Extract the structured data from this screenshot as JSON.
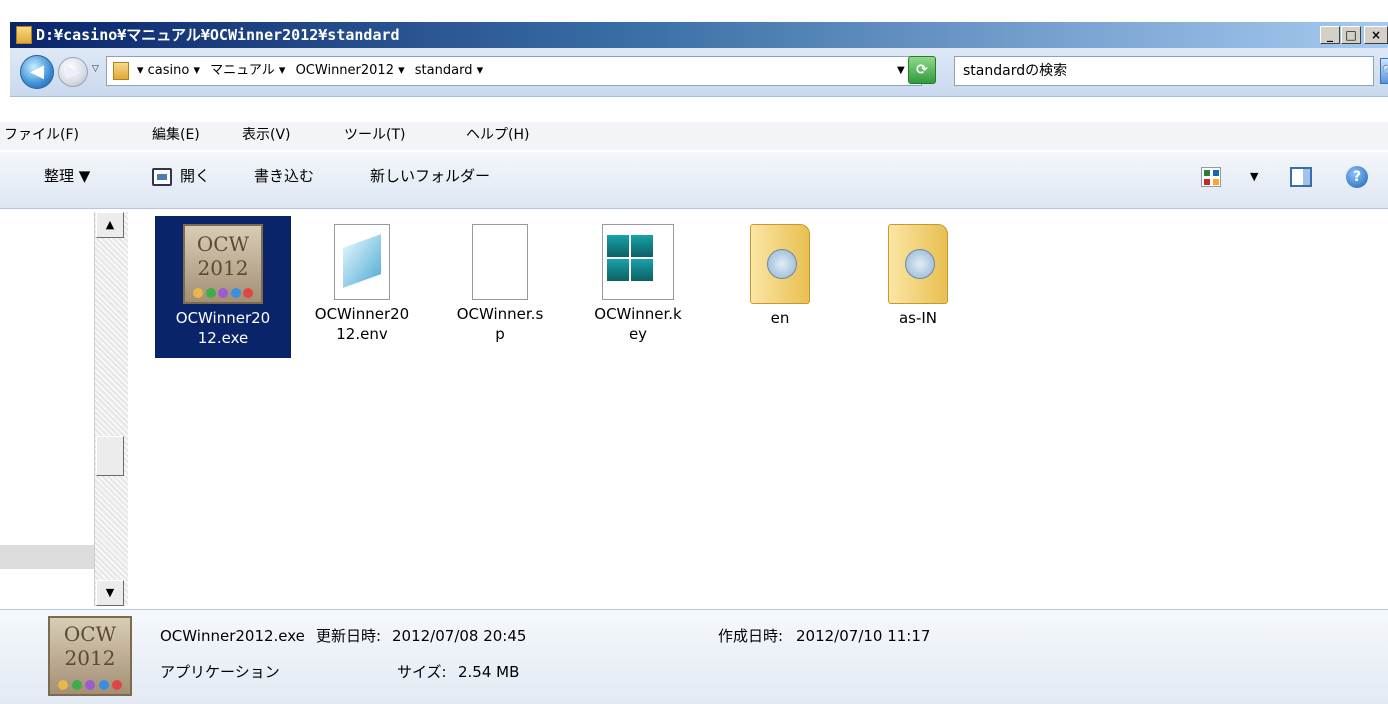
{
  "window": {
    "title": "D:¥casino¥マニュアル¥OCWinner2012¥standard",
    "minimize": "_",
    "maximize": "□",
    "close": "×"
  },
  "nav": {
    "back_glyph": "◀",
    "forward_glyph": "▶",
    "history_dropdown": "▽",
    "breadcrumbs": [
      "▾ casino ▾",
      "マニュアル ▾",
      "OCWinner2012 ▾",
      "standard ▾"
    ],
    "address_dropdown": "▼",
    "refresh_glyph": "⟳",
    "search_value": "standardの検索",
    "search_glyph": "🔍"
  },
  "menu": {
    "items": [
      "ファイル(F)",
      "編集(E)",
      "表示(V)",
      "ツール(T)",
      "ヘルプ(H)"
    ]
  },
  "commands": {
    "organize": "整理 ▼",
    "open": "開く",
    "write": "書き込む",
    "new_folder": "新しいフォルダー",
    "views_dropdown": "▼",
    "help_glyph": "?"
  },
  "scrollbar": {
    "up": "▲",
    "down": "▼"
  },
  "files": [
    {
      "name": "OCWinner2012.exe",
      "label_line1": "OCWinner20",
      "label_line2": "12.exe",
      "icon": "ocw-app-icon",
      "icon_text1": "OCW",
      "icon_text2": "2012",
      "selected": true
    },
    {
      "name": "OCWinner2012.env",
      "label_line1": "OCWinner20",
      "label_line2": "12.env",
      "icon": "document-icon",
      "selected": false
    },
    {
      "name": "OCWinner.sp",
      "label_line1": "OCWinner.s",
      "label_line2": "p",
      "icon": "blank-file-icon",
      "selected": false
    },
    {
      "name": "OCWinner.key",
      "label_line1": "OCWinner.k",
      "label_line2": "ey",
      "icon": "registry-file-icon",
      "selected": false
    },
    {
      "name": "en",
      "label_line1": "en",
      "label_line2": "",
      "icon": "folder-icon",
      "selected": false
    },
    {
      "name": "as-IN",
      "label_line1": "as-IN",
      "label_line2": "",
      "icon": "folder-icon",
      "selected": false
    }
  ],
  "details": {
    "filename": "OCWinner2012.exe",
    "type": "アプリケーション",
    "modified_label": "更新日時:",
    "modified_value": "2012/07/08 20:45",
    "created_label": "作成日時:",
    "created_value": "2012/07/10 11:17",
    "size_label": "サイズ:",
    "size_value": "2.54 MB",
    "icon_text1": "OCW",
    "icon_text2": "2012"
  },
  "colors": {
    "selection": "#0a246a",
    "title_gradient_start": "#0a246a",
    "title_gradient_end": "#a6caf0"
  }
}
